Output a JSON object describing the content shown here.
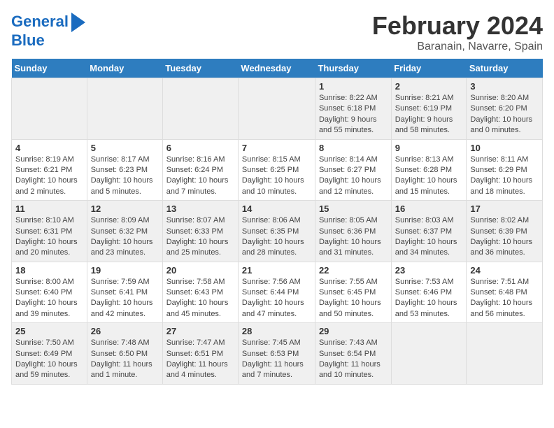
{
  "logo": {
    "line1": "General",
    "line2": "Blue"
  },
  "title": "February 2024",
  "location": "Baranain, Navarre, Spain",
  "days_of_week": [
    "Sunday",
    "Monday",
    "Tuesday",
    "Wednesday",
    "Thursday",
    "Friday",
    "Saturday"
  ],
  "weeks": [
    [
      {
        "day": "",
        "info": ""
      },
      {
        "day": "",
        "info": ""
      },
      {
        "day": "",
        "info": ""
      },
      {
        "day": "",
        "info": ""
      },
      {
        "day": "1",
        "info": "Sunrise: 8:22 AM\nSunset: 6:18 PM\nDaylight: 9 hours and 55 minutes."
      },
      {
        "day": "2",
        "info": "Sunrise: 8:21 AM\nSunset: 6:19 PM\nDaylight: 9 hours and 58 minutes."
      },
      {
        "day": "3",
        "info": "Sunrise: 8:20 AM\nSunset: 6:20 PM\nDaylight: 10 hours and 0 minutes."
      }
    ],
    [
      {
        "day": "4",
        "info": "Sunrise: 8:19 AM\nSunset: 6:21 PM\nDaylight: 10 hours and 2 minutes."
      },
      {
        "day": "5",
        "info": "Sunrise: 8:17 AM\nSunset: 6:23 PM\nDaylight: 10 hours and 5 minutes."
      },
      {
        "day": "6",
        "info": "Sunrise: 8:16 AM\nSunset: 6:24 PM\nDaylight: 10 hours and 7 minutes."
      },
      {
        "day": "7",
        "info": "Sunrise: 8:15 AM\nSunset: 6:25 PM\nDaylight: 10 hours and 10 minutes."
      },
      {
        "day": "8",
        "info": "Sunrise: 8:14 AM\nSunset: 6:27 PM\nDaylight: 10 hours and 12 minutes."
      },
      {
        "day": "9",
        "info": "Sunrise: 8:13 AM\nSunset: 6:28 PM\nDaylight: 10 hours and 15 minutes."
      },
      {
        "day": "10",
        "info": "Sunrise: 8:11 AM\nSunset: 6:29 PM\nDaylight: 10 hours and 18 minutes."
      }
    ],
    [
      {
        "day": "11",
        "info": "Sunrise: 8:10 AM\nSunset: 6:31 PM\nDaylight: 10 hours and 20 minutes."
      },
      {
        "day": "12",
        "info": "Sunrise: 8:09 AM\nSunset: 6:32 PM\nDaylight: 10 hours and 23 minutes."
      },
      {
        "day": "13",
        "info": "Sunrise: 8:07 AM\nSunset: 6:33 PM\nDaylight: 10 hours and 25 minutes."
      },
      {
        "day": "14",
        "info": "Sunrise: 8:06 AM\nSunset: 6:35 PM\nDaylight: 10 hours and 28 minutes."
      },
      {
        "day": "15",
        "info": "Sunrise: 8:05 AM\nSunset: 6:36 PM\nDaylight: 10 hours and 31 minutes."
      },
      {
        "day": "16",
        "info": "Sunrise: 8:03 AM\nSunset: 6:37 PM\nDaylight: 10 hours and 34 minutes."
      },
      {
        "day": "17",
        "info": "Sunrise: 8:02 AM\nSunset: 6:39 PM\nDaylight: 10 hours and 36 minutes."
      }
    ],
    [
      {
        "day": "18",
        "info": "Sunrise: 8:00 AM\nSunset: 6:40 PM\nDaylight: 10 hours and 39 minutes."
      },
      {
        "day": "19",
        "info": "Sunrise: 7:59 AM\nSunset: 6:41 PM\nDaylight: 10 hours and 42 minutes."
      },
      {
        "day": "20",
        "info": "Sunrise: 7:58 AM\nSunset: 6:43 PM\nDaylight: 10 hours and 45 minutes."
      },
      {
        "day": "21",
        "info": "Sunrise: 7:56 AM\nSunset: 6:44 PM\nDaylight: 10 hours and 47 minutes."
      },
      {
        "day": "22",
        "info": "Sunrise: 7:55 AM\nSunset: 6:45 PM\nDaylight: 10 hours and 50 minutes."
      },
      {
        "day": "23",
        "info": "Sunrise: 7:53 AM\nSunset: 6:46 PM\nDaylight: 10 hours and 53 minutes."
      },
      {
        "day": "24",
        "info": "Sunrise: 7:51 AM\nSunset: 6:48 PM\nDaylight: 10 hours and 56 minutes."
      }
    ],
    [
      {
        "day": "25",
        "info": "Sunrise: 7:50 AM\nSunset: 6:49 PM\nDaylight: 10 hours and 59 minutes."
      },
      {
        "day": "26",
        "info": "Sunrise: 7:48 AM\nSunset: 6:50 PM\nDaylight: 11 hours and 1 minute."
      },
      {
        "day": "27",
        "info": "Sunrise: 7:47 AM\nSunset: 6:51 PM\nDaylight: 11 hours and 4 minutes."
      },
      {
        "day": "28",
        "info": "Sunrise: 7:45 AM\nSunset: 6:53 PM\nDaylight: 11 hours and 7 minutes."
      },
      {
        "day": "29",
        "info": "Sunrise: 7:43 AM\nSunset: 6:54 PM\nDaylight: 11 hours and 10 minutes."
      },
      {
        "day": "",
        "info": ""
      },
      {
        "day": "",
        "info": ""
      }
    ]
  ]
}
